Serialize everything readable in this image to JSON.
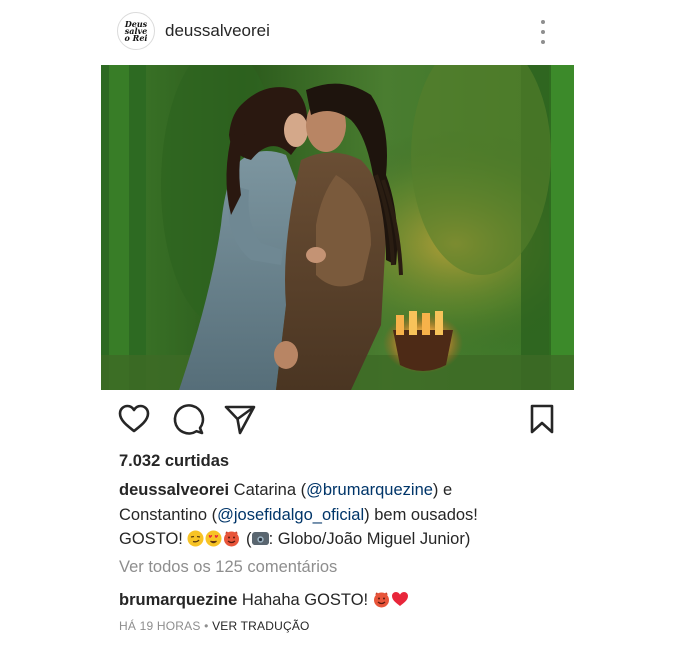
{
  "post": {
    "header": {
      "username": "deussalveorei",
      "avatar_text": "Deus salve o Rei",
      "more_icon": "more-vertical-icon"
    },
    "photo": {
      "alt": ""
    },
    "actions": {
      "like_icon": "heart-outline-icon",
      "comment_icon": "comment-bubble-icon",
      "share_icon": "paper-plane-icon",
      "save_icon": "bookmark-outline-icon"
    },
    "likes": "7.032 curtidas",
    "caption": {
      "username": "deussalveorei",
      "text_1": "Catarina (",
      "mention_1": "@brumarquezine",
      "text_2": ") e Constantino (",
      "mention_2": "@josefidalgo_oficial",
      "text_3": ") bem ousados! GOSTO! ",
      "text_4": " (",
      "text_5": ": Globo/João Miguel Junior)"
    },
    "view_all_comments": "Ver todos os 125 comentários",
    "top_comment": {
      "username": "brumarquezine",
      "text": "Hahaha GOSTO!"
    },
    "meta": {
      "time": "HÁ 19 HORAS",
      "separator": "•",
      "translate": "VER TRADUÇÃO"
    },
    "colors": {
      "text": "#262626",
      "muted": "#8e8e8e",
      "mention": "#003569",
      "heart": "#ed4956"
    }
  }
}
